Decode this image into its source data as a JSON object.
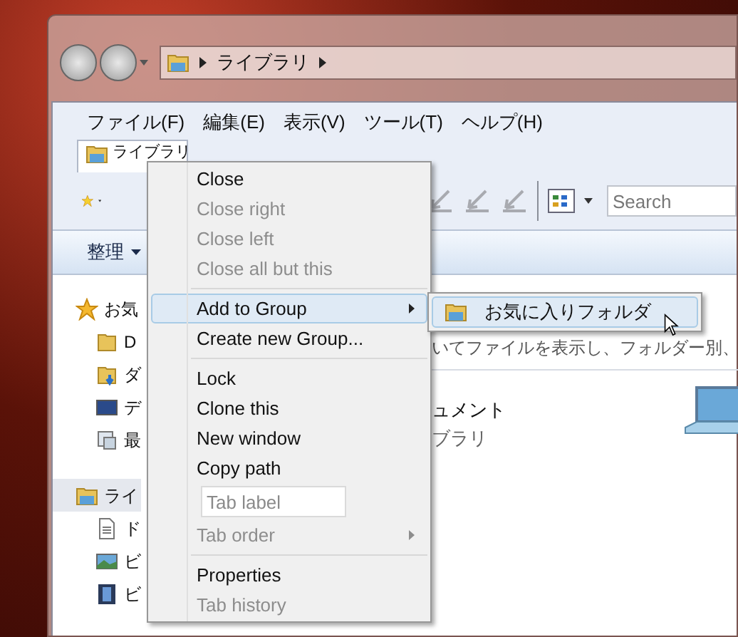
{
  "address_bar": {
    "crumbs": [
      "ライブラリ"
    ]
  },
  "menu_bar": [
    "ファイル(F)",
    "編集(E)",
    "表示(V)",
    "ツール(T)",
    "ヘルプ(H)"
  ],
  "tabs": [
    {
      "label": "ライブラリ",
      "selected": true
    }
  ],
  "search": {
    "placeholder": "Search"
  },
  "command_bar": {
    "organize": "整理"
  },
  "nav_pane": {
    "groups": [
      {
        "label": "お気",
        "kind": "star",
        "selected": false,
        "children": [
          {
            "label": "D",
            "kind": "folder",
            "selected": false
          },
          {
            "label": "ダ",
            "kind": "download",
            "selected": false
          },
          {
            "label": "デ",
            "kind": "desktop",
            "selected": false
          },
          {
            "label": "最",
            "kind": "recent",
            "selected": false
          }
        ]
      },
      {
        "label": "ライ",
        "kind": "library",
        "selected": true,
        "children": [
          {
            "label": "ド",
            "kind": "document",
            "selected": false
          },
          {
            "label": "ビ",
            "kind": "picture",
            "selected": false
          },
          {
            "label": "ビ",
            "kind": "video",
            "selected": false
          }
        ]
      }
    ]
  },
  "content": {
    "description": "いてファイルを表示し、フォルダー別、",
    "item": {
      "name": "ュメント",
      "subtitle": "ブラリ"
    }
  },
  "context_menu": {
    "items": [
      {
        "kind": "item",
        "label": "Close",
        "disabled": false,
        "submenu": false,
        "selected": false
      },
      {
        "kind": "item",
        "label": "Close right",
        "disabled": true,
        "submenu": false,
        "selected": false
      },
      {
        "kind": "item",
        "label": "Close left",
        "disabled": true,
        "submenu": false,
        "selected": false
      },
      {
        "kind": "item",
        "label": "Close all but this",
        "disabled": true,
        "submenu": false,
        "selected": false
      },
      {
        "kind": "separator"
      },
      {
        "kind": "item",
        "label": "Add to Group",
        "disabled": false,
        "submenu": true,
        "selected": true
      },
      {
        "kind": "item",
        "label": "Create new Group...",
        "disabled": false,
        "submenu": false,
        "selected": false
      },
      {
        "kind": "separator"
      },
      {
        "kind": "item",
        "label": "Lock",
        "disabled": false,
        "submenu": false,
        "selected": false
      },
      {
        "kind": "item",
        "label": "Clone this",
        "disabled": false,
        "submenu": false,
        "selected": false
      },
      {
        "kind": "item",
        "label": "New window",
        "disabled": false,
        "submenu": false,
        "selected": false
      },
      {
        "kind": "item",
        "label": "Copy path",
        "disabled": false,
        "submenu": false,
        "selected": false
      },
      {
        "kind": "field",
        "placeholder": "Tab label"
      },
      {
        "kind": "item",
        "label": "Tab order",
        "disabled": true,
        "submenu": true,
        "selected": false
      },
      {
        "kind": "separator"
      },
      {
        "kind": "item",
        "label": "Properties",
        "disabled": false,
        "submenu": false,
        "selected": false
      },
      {
        "kind": "item",
        "label": "Tab history",
        "disabled": true,
        "submenu": false,
        "selected": false
      }
    ]
  },
  "submenu": {
    "items": [
      {
        "label": "お気に入りフォルダ",
        "selected": true
      }
    ]
  }
}
